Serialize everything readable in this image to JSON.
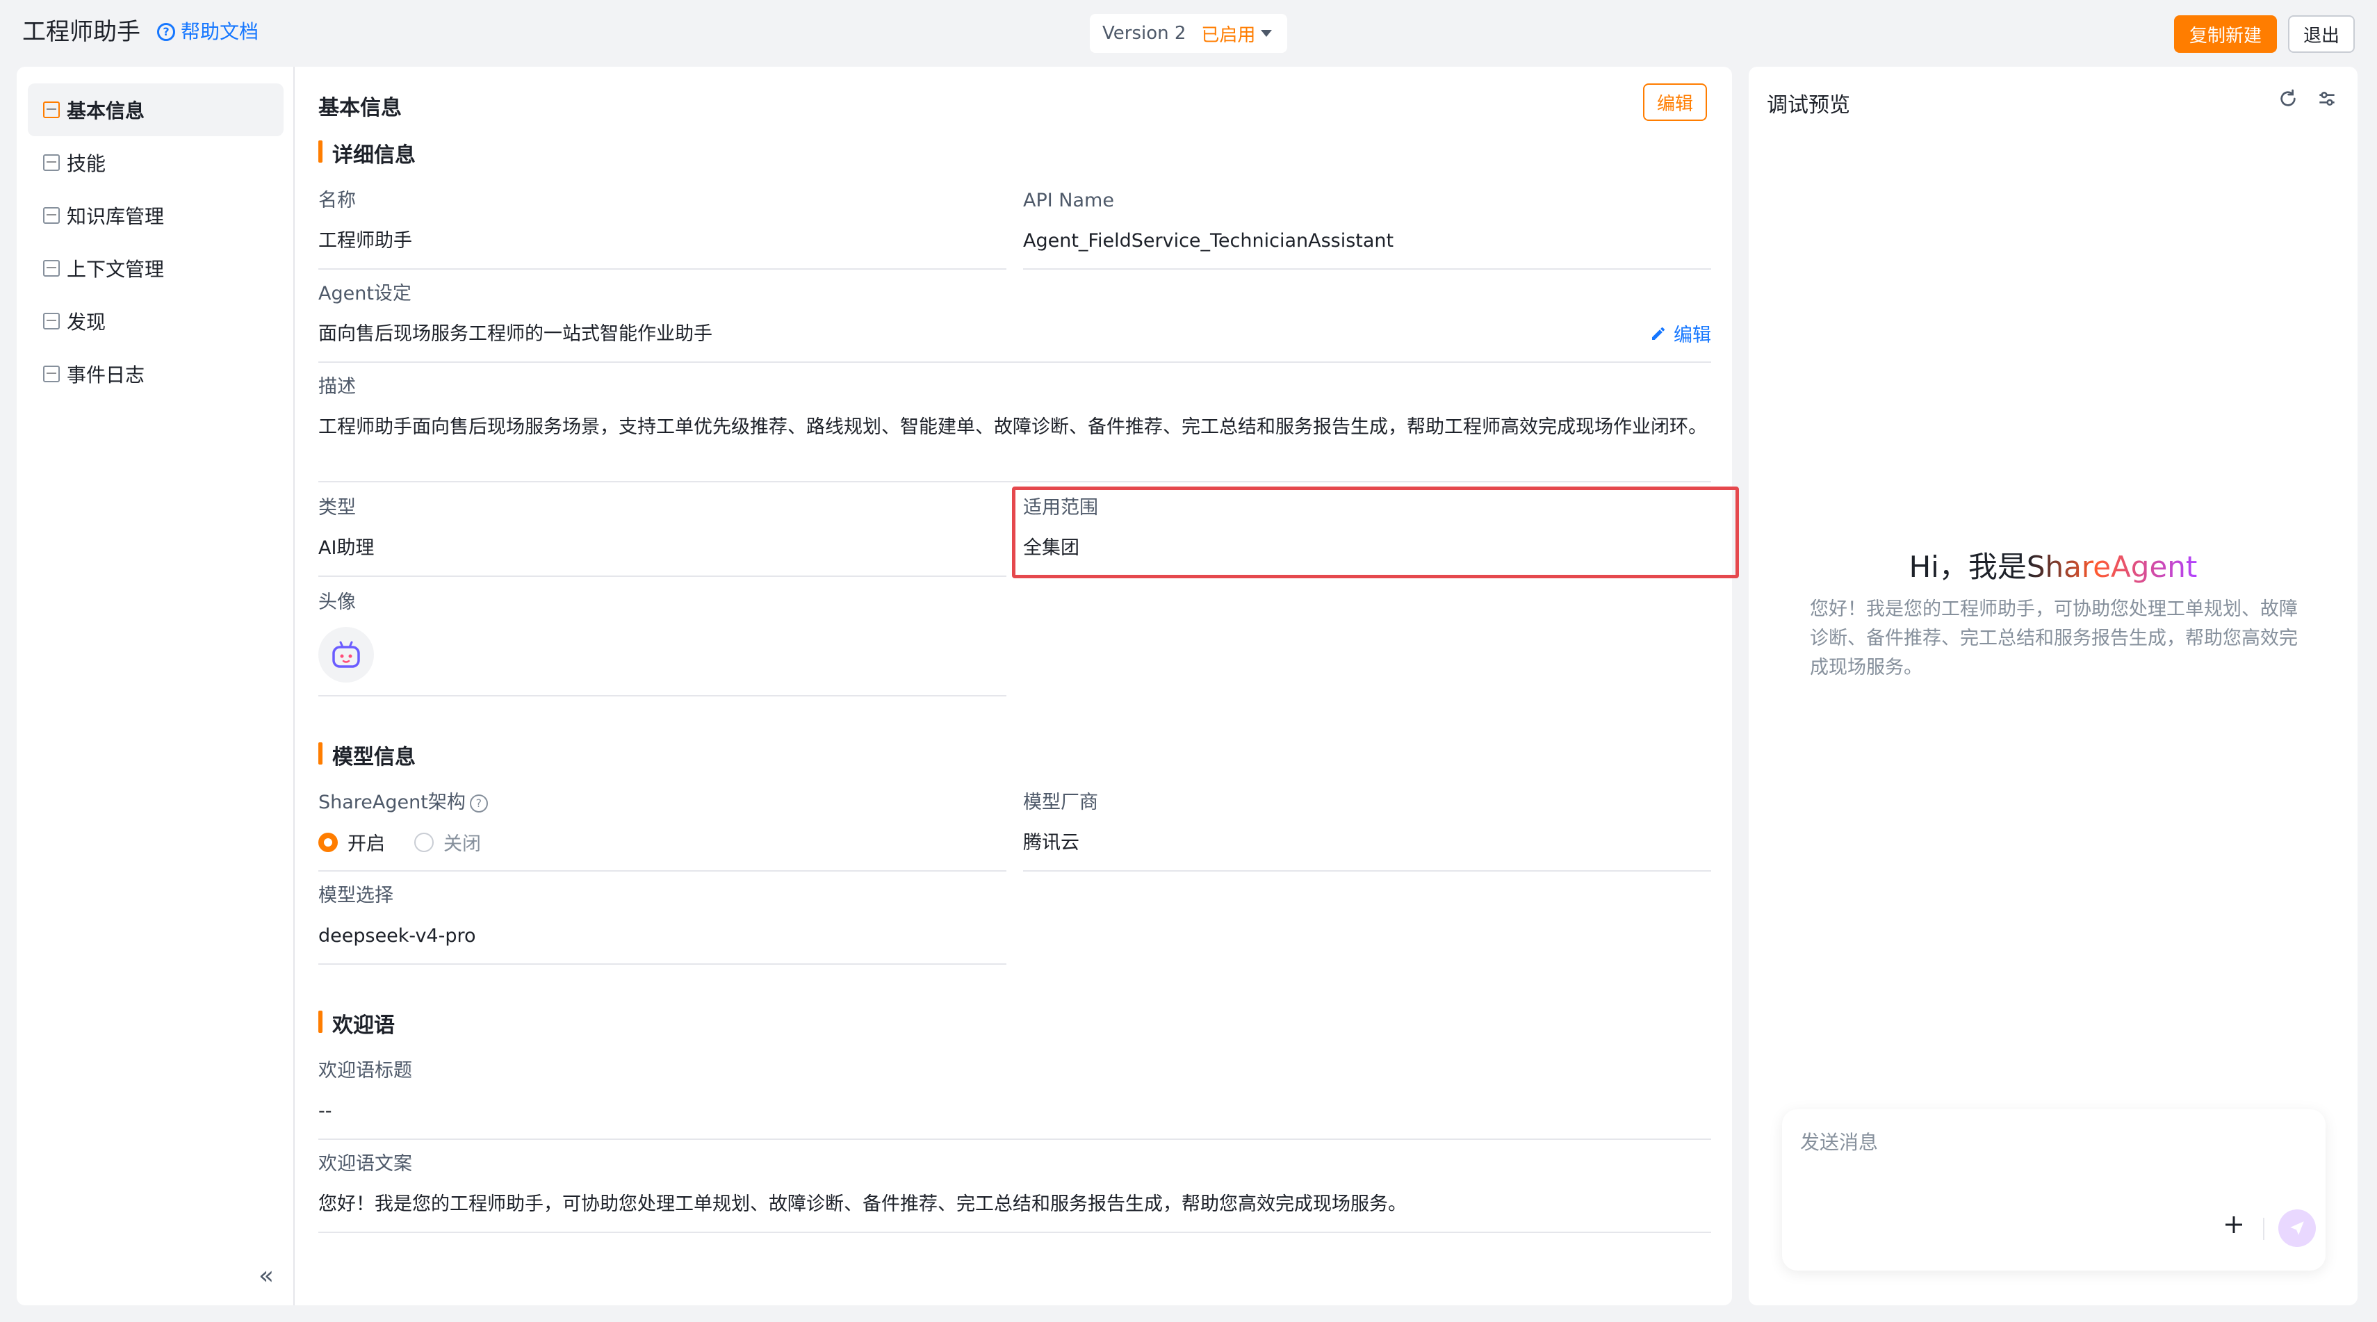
{
  "header": {
    "app_title": "工程师助手",
    "help_label": "帮助文档",
    "version_label": "Version 2",
    "version_status": "已启用",
    "copy_label": "复制新建",
    "exit_label": "退出"
  },
  "sidebar": {
    "items": [
      {
        "label": "基本信息",
        "icon": "card-icon"
      },
      {
        "label": "技能",
        "icon": "list-icon"
      },
      {
        "label": "知识库管理",
        "icon": "book-icon"
      },
      {
        "label": "上下文管理",
        "icon": "code-icon"
      },
      {
        "label": "发现",
        "icon": "box-icon"
      },
      {
        "label": "事件日志",
        "icon": "log-icon"
      }
    ],
    "collapse_glyph": "«"
  },
  "main": {
    "title": "基本信息",
    "edit_label": "编辑",
    "detail_section": "详细信息",
    "name_label": "名称",
    "name_value": "工程师助手",
    "api_label": "API Name",
    "api_value": "Agent_FieldService_TechnicianAssistant",
    "agent_setting_label": "Agent设定",
    "agent_setting_value": "面向售后现场服务工程师的一站式智能作业助手",
    "agent_setting_edit": "编辑",
    "desc_label": "描述",
    "desc_value": "工程师助手面向售后现场服务场景，支持工单优先级推荐、路线规划、智能建单、故障诊断、备件推荐、完工总结和服务报告生成，帮助工程师高效完成现场作业闭环。",
    "type_label": "类型",
    "type_value": "AI助理",
    "scope_label": "适用范围",
    "scope_value": "全集团",
    "avatar_label": "头像",
    "model_section": "模型信息",
    "arch_label": "ShareAgent架构",
    "arch_on": "开启",
    "arch_off": "关闭",
    "vendor_label": "模型厂商",
    "vendor_value": "腾讯云",
    "model_label": "模型选择",
    "model_value": "deepseek-v4-pro",
    "welcome_section": "欢迎语",
    "welcome_title_label": "欢迎语标题",
    "welcome_title_value": "--",
    "welcome_text_label": "欢迎语文案",
    "welcome_text_value": "您好！我是您的工程师助手，可协助您处理工单规划、故障诊断、备件推荐、完工总结和服务报告生成，帮助您高效完成现场服务。"
  },
  "preview": {
    "title": "调试预览",
    "greet_prefix": "Hi，我是",
    "greet_brand": "ShareAgent",
    "greet_text": "您好！我是您的工程师助手，可协助您处理工单规划、故障诊断、备件推荐、完工总结和服务报告生成，帮助您高效完成现场服务。",
    "chat_placeholder": "发送消息"
  },
  "colors": {
    "accent": "#ff7d00",
    "link": "#1677ff",
    "highlight": "#e5484d"
  }
}
